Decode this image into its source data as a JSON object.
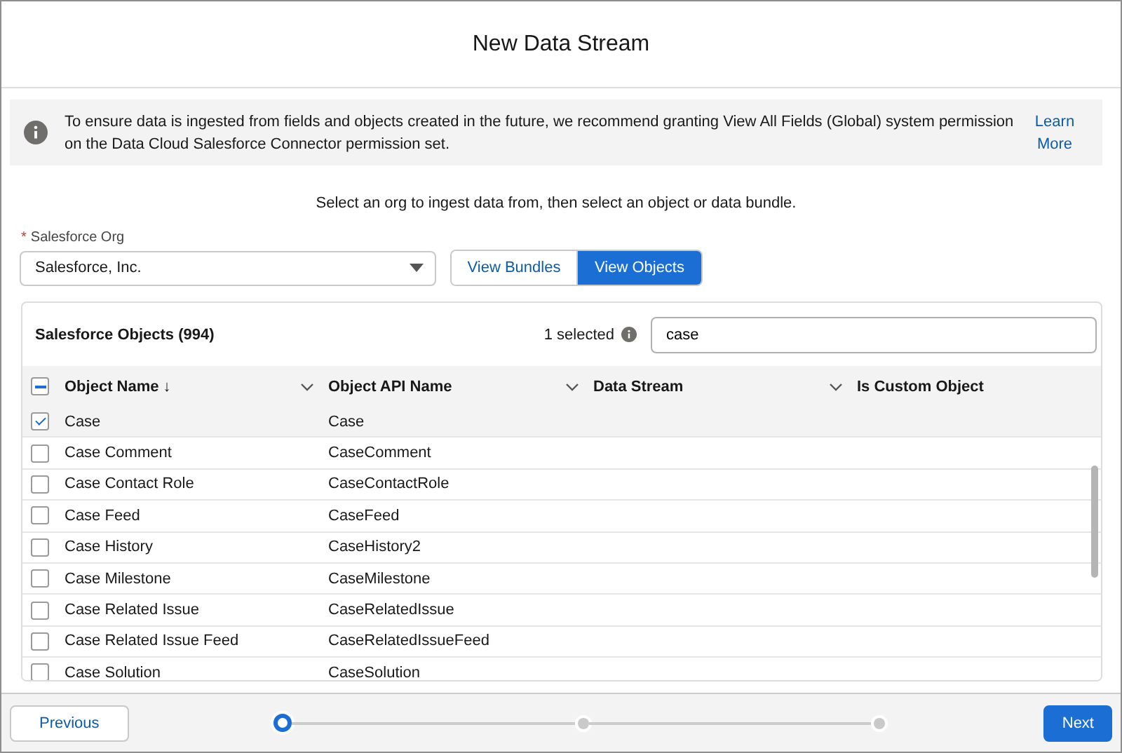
{
  "window": {
    "title": "New Data Stream"
  },
  "notice": {
    "text": "To ensure data is ingested from fields and objects created in the future, we recommend granting View All Fields (Global) system permission on the Data Cloud Salesforce Connector permission set.",
    "link": "Learn More"
  },
  "instruction": "Select an org to ingest data from, then select an object or data bundle.",
  "org_field": {
    "label": "Salesforce Org",
    "required_mark": "*",
    "value": "Salesforce, Inc."
  },
  "view_toggle": [
    {
      "label": "View Bundles",
      "selected": false
    },
    {
      "label": "View Objects",
      "selected": true
    }
  ],
  "table": {
    "title": "Salesforce Objects (994)",
    "selected_count": "1 selected",
    "search": {
      "value": "case"
    },
    "header_checkbox": {
      "indeterminate": true
    },
    "columns": [
      {
        "label": "Object Name",
        "sort_indicator": "↓",
        "has_menu": true
      },
      {
        "label": "Object API Name",
        "has_menu": true
      },
      {
        "label": "Data Stream",
        "has_menu": true
      },
      {
        "label": "Is Custom Object",
        "has_menu": false
      }
    ],
    "rows": [
      {
        "name": "Case",
        "api_name": "Case",
        "checked": true
      },
      {
        "name": "Case Comment",
        "api_name": "CaseComment",
        "checked": false
      },
      {
        "name": "Case Contact Role",
        "api_name": "CaseContactRole",
        "checked": false
      },
      {
        "name": "Case Feed",
        "api_name": "CaseFeed",
        "checked": false
      },
      {
        "name": "Case History",
        "api_name": "CaseHistory2",
        "checked": false
      },
      {
        "name": "Case Milestone",
        "api_name": "CaseMilestone",
        "checked": false
      },
      {
        "name": "Case Related Issue",
        "api_name": "CaseRelatedIssue",
        "checked": false
      },
      {
        "name": "Case Related Issue Feed",
        "api_name": "CaseRelatedIssueFeed",
        "checked": false
      },
      {
        "name": "Case Solution",
        "api_name": "CaseSolution",
        "checked": false
      }
    ]
  },
  "footer": {
    "previous": "Previous",
    "next": "Next",
    "steps": [
      {
        "selected": true
      },
      {
        "selected": false
      },
      {
        "selected": false
      }
    ]
  }
}
